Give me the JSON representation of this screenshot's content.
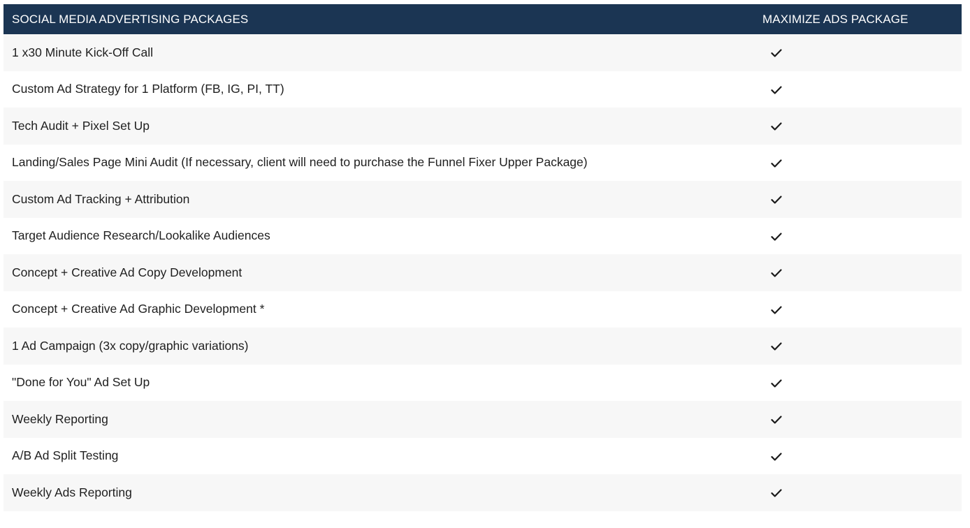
{
  "table": {
    "header": {
      "feature_label": "SOCIAL MEDIA ADVERTISING PACKAGES",
      "package_label": "MAXIMIZE ADS PACKAGE"
    },
    "rows": [
      {
        "feature": "1 x30 Minute Kick-Off Call",
        "included_icon": "check-icon"
      },
      {
        "feature": "Custom Ad Strategy for 1 Platform (FB, IG, PI, TT)",
        "included_icon": "check-icon"
      },
      {
        "feature": "Tech Audit + Pixel Set Up",
        "included_icon": "check-icon"
      },
      {
        "feature": "Landing/Sales Page Mini Audit (If necessary, client will need to purchase the Funnel Fixer Upper Package)",
        "included_icon": "check-icon"
      },
      {
        "feature": "Custom Ad Tracking + Attribution",
        "included_icon": "check-icon"
      },
      {
        "feature": "Target Audience Research/Lookalike Audiences",
        "included_icon": "check-icon"
      },
      {
        "feature": "Concept + Creative Ad Copy Development",
        "included_icon": "check-icon"
      },
      {
        "feature": "Concept + Creative Ad Graphic Development *",
        "included_icon": "check-icon"
      },
      {
        "feature": "1 Ad Campaign (3x copy/graphic variations)",
        "included_icon": "check-icon"
      },
      {
        "feature": "\"Done for You\" Ad Set Up",
        "included_icon": "check-icon"
      },
      {
        "feature": "Weekly Reporting",
        "included_icon": "check-icon"
      },
      {
        "feature": "A/B Ad Split Testing",
        "included_icon": "check-icon"
      },
      {
        "feature": "Weekly Ads Reporting",
        "included_icon": "check-icon"
      }
    ]
  },
  "colors": {
    "header_bg": "#1b3553",
    "header_text": "#ffffff",
    "row_alt_bg": "#f7f7f7",
    "row_bg": "#ffffff",
    "text": "#1f1f1f"
  }
}
